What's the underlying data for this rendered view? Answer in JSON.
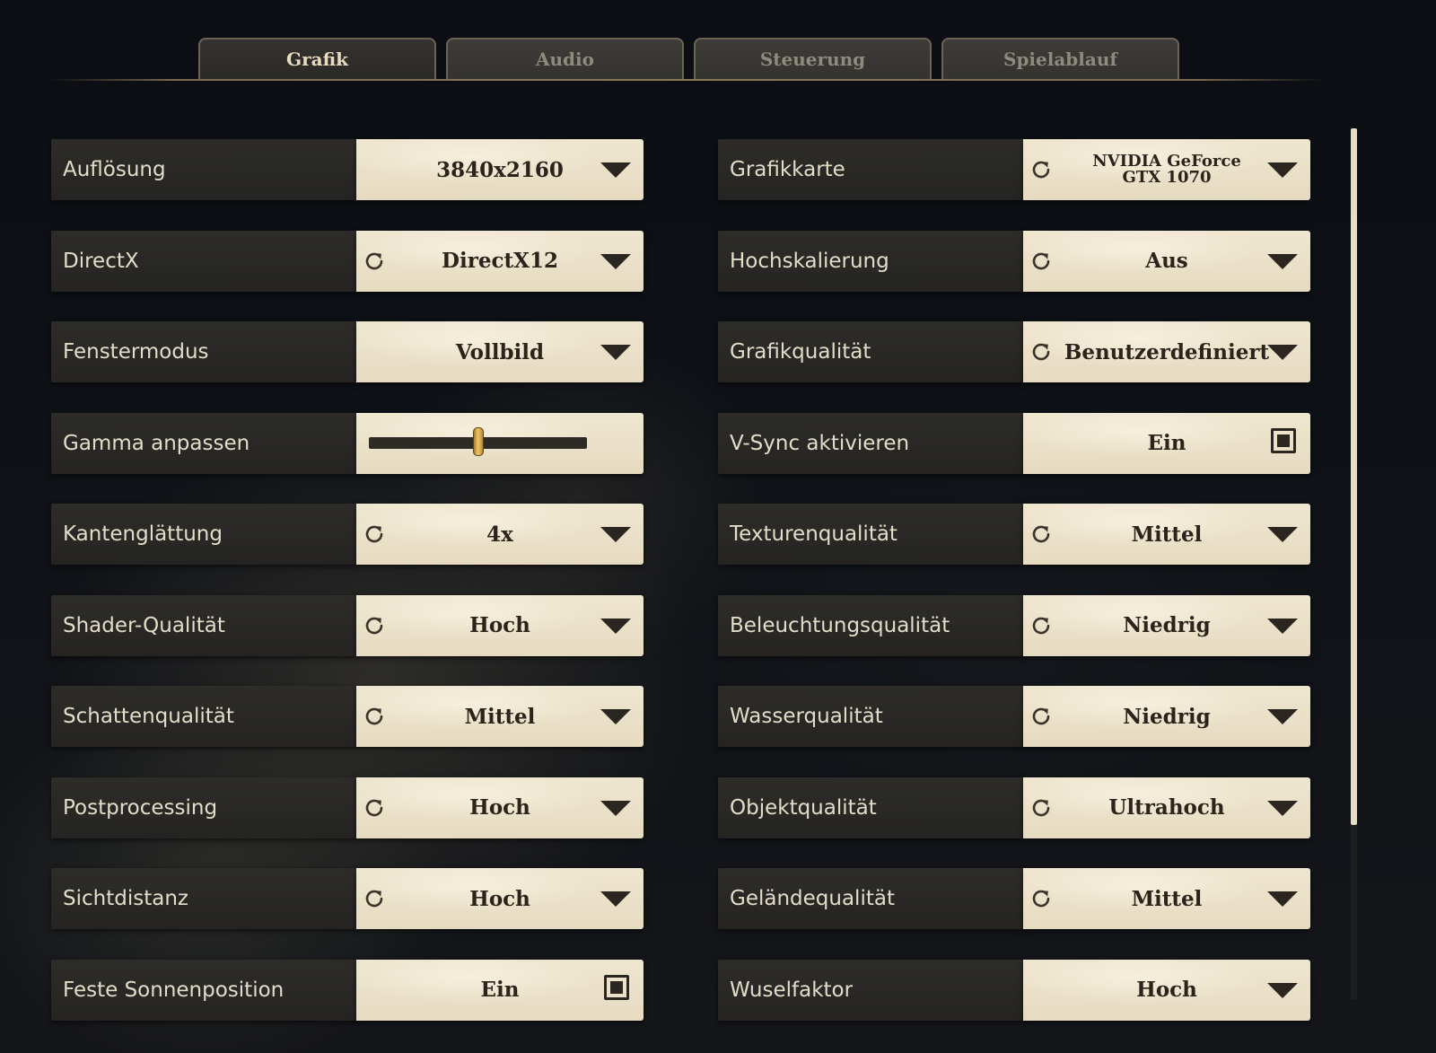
{
  "tabs": [
    {
      "label": "Grafik",
      "active": true
    },
    {
      "label": "Audio",
      "active": false
    },
    {
      "label": "Steuerung",
      "active": false
    },
    {
      "label": "Spielablauf",
      "active": false
    }
  ],
  "settings_left": [
    {
      "label": "Auflösung",
      "value": "3840x2160",
      "control": "dropdown",
      "reset": false
    },
    {
      "label": "DirectX",
      "value": "DirectX12",
      "control": "dropdown",
      "reset": true
    },
    {
      "label": "Fenstermodus",
      "value": "Vollbild",
      "control": "dropdown",
      "reset": false
    },
    {
      "label": "Gamma anpassen",
      "control": "slider",
      "slider_fraction": 0.5
    },
    {
      "label": "Kantenglättung",
      "value": "4x",
      "control": "dropdown",
      "reset": true
    },
    {
      "label": "Shader-Qualität",
      "value": "Hoch",
      "control": "dropdown",
      "reset": true
    },
    {
      "label": "Schattenqualität",
      "value": "Mittel",
      "control": "dropdown",
      "reset": true
    },
    {
      "label": "Postprocessing",
      "value": "Hoch",
      "control": "dropdown",
      "reset": true
    },
    {
      "label": "Sichtdistanz",
      "value": "Hoch",
      "control": "dropdown",
      "reset": true
    },
    {
      "label": "Feste Sonnenposition",
      "value": "Ein",
      "control": "checkbox",
      "checked": true,
      "reset": false
    }
  ],
  "settings_right": [
    {
      "label": "Grafikkarte",
      "value": "NVIDIA GeForce GTX 1070",
      "control": "dropdown",
      "reset": true,
      "small": true
    },
    {
      "label": "Hochskalierung",
      "value": "Aus",
      "control": "dropdown",
      "reset": true
    },
    {
      "label": "Grafikqualität",
      "value": "Benutzerdefiniert",
      "control": "dropdown",
      "reset": true
    },
    {
      "label": "V-Sync aktivieren",
      "value": "Ein",
      "control": "checkbox",
      "checked": true,
      "reset": false
    },
    {
      "label": "Texturenqualität",
      "value": "Mittel",
      "control": "dropdown",
      "reset": true
    },
    {
      "label": "Beleuchtungsqualität",
      "value": "Niedrig",
      "control": "dropdown",
      "reset": true
    },
    {
      "label": "Wasserqualität",
      "value": "Niedrig",
      "control": "dropdown",
      "reset": true
    },
    {
      "label": "Objektqualität",
      "value": "Ultrahoch",
      "control": "dropdown",
      "reset": true
    },
    {
      "label": "Geländequalität",
      "value": "Mittel",
      "control": "dropdown",
      "reset": true
    },
    {
      "label": "Wuselfaktor",
      "value": "Hoch",
      "control": "dropdown",
      "reset": false
    }
  ],
  "icons": {
    "reset": "reset-icon",
    "dropdown": "chevron-down-icon",
    "checkbox": "checkbox-icon"
  },
  "colors": {
    "label_bg": "#2d2c29",
    "control_bg": "#efe6d0",
    "text_dark": "#2a241b",
    "text_light": "#e3dcc9",
    "accent_gold": "#f0c767"
  },
  "scrollbar": {
    "visible_fraction": 0.8
  }
}
